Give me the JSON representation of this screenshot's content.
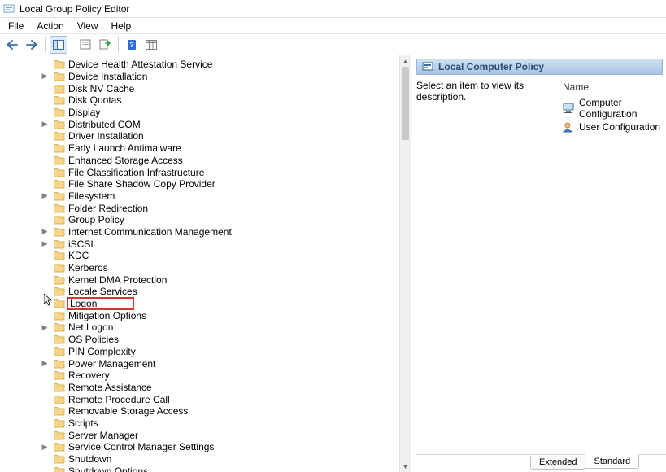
{
  "window": {
    "title": "Local Group Policy Editor"
  },
  "menu": {
    "file": "File",
    "action": "Action",
    "view": "View",
    "help": "Help"
  },
  "tree": {
    "items": [
      {
        "label": "Device Health Attestation Service",
        "expandable": false
      },
      {
        "label": "Device Installation",
        "expandable": true
      },
      {
        "label": "Disk NV Cache",
        "expandable": false
      },
      {
        "label": "Disk Quotas",
        "expandable": false
      },
      {
        "label": "Display",
        "expandable": false
      },
      {
        "label": "Distributed COM",
        "expandable": true
      },
      {
        "label": "Driver Installation",
        "expandable": false
      },
      {
        "label": "Early Launch Antimalware",
        "expandable": false
      },
      {
        "label": "Enhanced Storage Access",
        "expandable": false
      },
      {
        "label": "File Classification Infrastructure",
        "expandable": false
      },
      {
        "label": "File Share Shadow Copy Provider",
        "expandable": false
      },
      {
        "label": "Filesystem",
        "expandable": true
      },
      {
        "label": "Folder Redirection",
        "expandable": false
      },
      {
        "label": "Group Policy",
        "expandable": false
      },
      {
        "label": "Internet Communication Management",
        "expandable": true
      },
      {
        "label": "iSCSI",
        "expandable": true
      },
      {
        "label": "KDC",
        "expandable": false
      },
      {
        "label": "Kerberos",
        "expandable": false
      },
      {
        "label": "Kernel DMA Protection",
        "expandable": false
      },
      {
        "label": "Locale Services",
        "expandable": false
      },
      {
        "label": "Logon",
        "expandable": false,
        "highlight": true
      },
      {
        "label": "Mitigation Options",
        "expandable": false
      },
      {
        "label": "Net Logon",
        "expandable": true
      },
      {
        "label": "OS Policies",
        "expandable": false
      },
      {
        "label": "PIN Complexity",
        "expandable": false
      },
      {
        "label": "Power Management",
        "expandable": true
      },
      {
        "label": "Recovery",
        "expandable": false
      },
      {
        "label": "Remote Assistance",
        "expandable": false
      },
      {
        "label": "Remote Procedure Call",
        "expandable": false
      },
      {
        "label": "Removable Storage Access",
        "expandable": false
      },
      {
        "label": "Scripts",
        "expandable": false
      },
      {
        "label": "Server Manager",
        "expandable": false
      },
      {
        "label": "Service Control Manager Settings",
        "expandable": true
      },
      {
        "label": "Shutdown",
        "expandable": false
      },
      {
        "label": "Shutdown Options",
        "expandable": false
      }
    ]
  },
  "right": {
    "header": "Local Computer Policy",
    "description_prompt": "Select an item to view its description.",
    "name_header": "Name",
    "items": [
      {
        "label": "Computer Configuration",
        "icon": "computer"
      },
      {
        "label": "User Configuration",
        "icon": "user"
      }
    ]
  },
  "tabs": {
    "extended": "Extended",
    "standard": "Standard",
    "active": "standard"
  }
}
